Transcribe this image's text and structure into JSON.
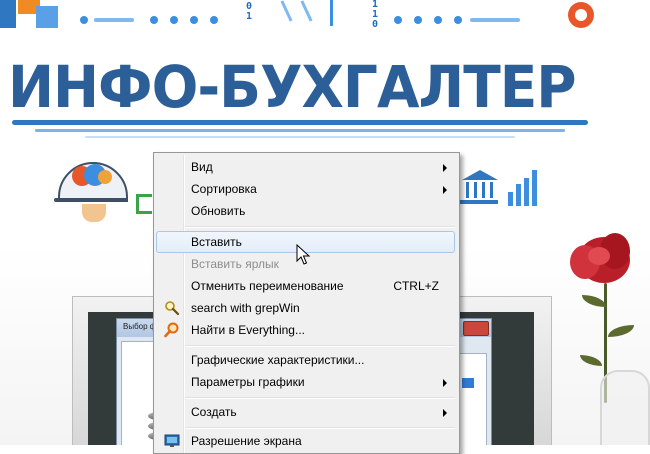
{
  "wallpaper": {
    "brand_title": "ИНФО-БУХГАЛТЕР",
    "binary_left": "0\n1",
    "binary_right": "1\n1\n0",
    "dialog_title": "Выбор ф",
    "brand_color": "#2c5f97"
  },
  "context_menu": {
    "items": [
      {
        "label": "Вид",
        "submenu": true
      },
      {
        "label": "Сортировка",
        "submenu": true
      },
      {
        "label": "Обновить"
      },
      {
        "label": "Вставить",
        "hover": true
      },
      {
        "label": "Вставить ярлык",
        "disabled": true
      },
      {
        "label": "Отменить переименование",
        "shortcut": "CTRL+Z"
      },
      {
        "label": "search with grepWin",
        "icon": "magnifier-icon"
      },
      {
        "label": "Найти в Everything...",
        "icon": "everything-search-icon"
      },
      {
        "label": "Графические характеристики..."
      },
      {
        "label": "Параметры графики",
        "submenu": true
      },
      {
        "label": "Создать",
        "submenu": true
      },
      {
        "label": "Разрешение экрана",
        "icon": "screen-resolution-icon"
      }
    ]
  },
  "colors": {
    "menu_bg": "#f0f0f0",
    "hover_border": "#a8c8ea",
    "disabled_text": "#8d8d8d"
  }
}
